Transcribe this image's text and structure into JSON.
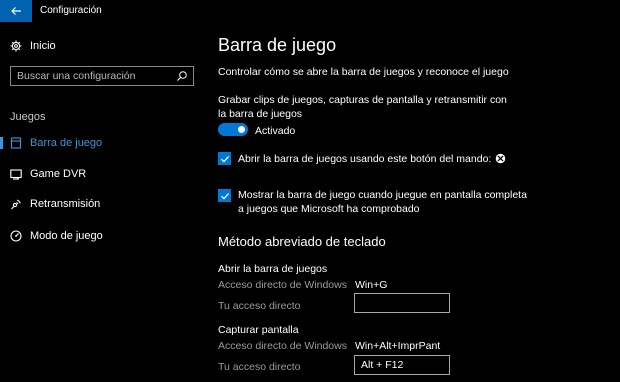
{
  "titlebar": {
    "app_title": "Configuración"
  },
  "sidebar": {
    "home_label": "Inicio",
    "search_placeholder": "Buscar una configuración",
    "section_label": "Juegos",
    "items": [
      {
        "label": "Barra de juego",
        "icon": "game-bar-icon",
        "active": true
      },
      {
        "label": "Game DVR",
        "icon": "game-dvr-icon",
        "active": false
      },
      {
        "label": "Retransmisión",
        "icon": "broadcast-icon",
        "active": false
      },
      {
        "label": "Modo de juego",
        "icon": "game-mode-icon",
        "active": false
      }
    ]
  },
  "main": {
    "title": "Barra de juego",
    "description": "Controlar cómo se abre la barra de juegos y reconoce el juego",
    "record_label": "Grabar clips de juegos, capturas de pantalla y retransmitir con la barra de juegos",
    "toggle_state": "Activado",
    "checkboxes": [
      {
        "label": "Abrir la barra de juegos usando este botón del mando:",
        "checked": true,
        "icon": "xbox-icon"
      },
      {
        "label": "Mostrar la barra de juego cuando juegue en pantalla completa a juegos que Microsoft ha comprobado",
        "checked": true
      }
    ],
    "shortcuts_title": "Método abreviado de teclado",
    "shortcut_groups": [
      {
        "title": "Abrir la barra de juegos",
        "windows_label": "Acceso directo de Windows",
        "windows_value": "Win+G",
        "custom_label": "Tu acceso directo",
        "custom_value": ""
      },
      {
        "title": "Capturar pantalla",
        "windows_label": "Acceso directo de Windows",
        "windows_value": "Win+Alt+ImprPant",
        "custom_label": "Tu acceso directo",
        "custom_value": "Alt + F12"
      }
    ]
  },
  "colors": {
    "accent": "#0078d7",
    "active_nav": "#3a96dd",
    "background": "#000000"
  }
}
